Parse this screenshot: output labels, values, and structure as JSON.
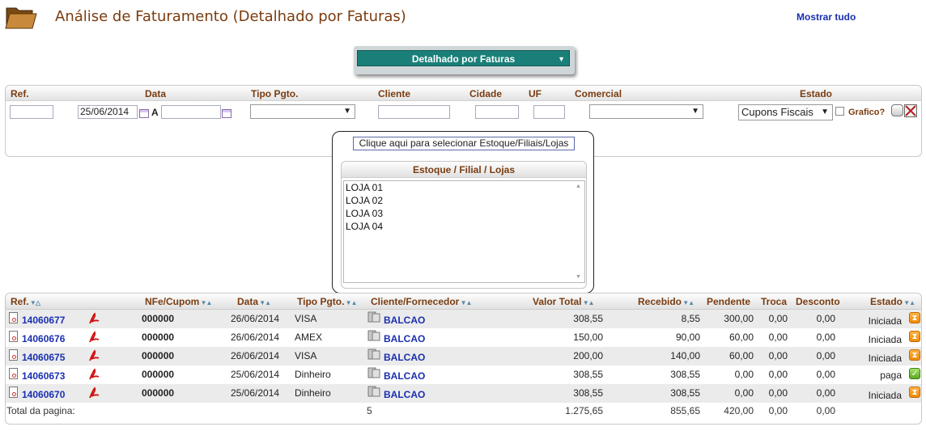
{
  "header": {
    "title": "Análise de Faturamento (Detalhado por Faturas)",
    "show_all": "Mostrar tudo",
    "view_selected": "Detalhado por Faturas"
  },
  "filters": {
    "labels": {
      "ref": "Ref.",
      "data": "Data",
      "tipo_pgto": "Tipo Pgto.",
      "cliente": "Cliente",
      "cidade": "Cidade",
      "uf": "UF",
      "comercial": "Comercial",
      "estado": "Estado"
    },
    "ref_value": "",
    "date_from": "25/06/2014",
    "date_sep": "A",
    "date_to": "",
    "tipo_pgto_value": "",
    "cliente_value": "",
    "cidade_value": "",
    "uf_value": "",
    "comercial_value": "",
    "estado_value": "Cupons Fiscais",
    "grafico_label": "Grafico?"
  },
  "stores": {
    "button_label": "Clique aqui para selecionar Estoque/Filiais/Lojas",
    "heading": "Estoque / Filial / Lojas",
    "items": [
      "LOJA 01",
      "LOJA 02",
      "LOJA 03",
      "LOJA 04"
    ]
  },
  "table": {
    "columns": {
      "ref": "Ref.",
      "nfe": "NFe/Cupom",
      "data": "Data",
      "tipo": "Tipo Pgto.",
      "cliente": "Cliente/Fornecedor",
      "valor": "Valor Total",
      "recebido": "Recebido",
      "pendente": "Pendente",
      "troca": "Troca",
      "desconto": "Desconto",
      "estado": "Estado"
    },
    "rows": [
      {
        "ref": "14060677",
        "nfe": "000000",
        "data": "26/06/2014",
        "tipo": "VISA",
        "cliente": "BALCAO",
        "valor": "308,55",
        "recebido": "8,55",
        "pendente": "300,00",
        "troca": "0,00",
        "desconto": "0,00",
        "estado": "Iniciada",
        "status_color": "#f08a00"
      },
      {
        "ref": "14060676",
        "nfe": "000000",
        "data": "26/06/2014",
        "tipo": "AMEX",
        "cliente": "BALCAO",
        "valor": "150,00",
        "recebido": "90,00",
        "pendente": "60,00",
        "troca": "0,00",
        "desconto": "0,00",
        "estado": "Iniciada",
        "status_color": "#f08a00"
      },
      {
        "ref": "14060675",
        "nfe": "000000",
        "data": "26/06/2014",
        "tipo": "VISA",
        "cliente": "BALCAO",
        "valor": "200,00",
        "recebido": "140,00",
        "pendente": "60,00",
        "troca": "0,00",
        "desconto": "0,00",
        "estado": "Iniciada",
        "status_color": "#f08a00"
      },
      {
        "ref": "14060673",
        "nfe": "000000",
        "data": "25/06/2014",
        "tipo": "Dinheiro",
        "cliente": "BALCAO",
        "valor": "308,55",
        "recebido": "308,55",
        "pendente": "0,00",
        "troca": "0,00",
        "desconto": "0,00",
        "estado": "paga",
        "status_color": "#5aaa20"
      },
      {
        "ref": "14060670",
        "nfe": "000000",
        "data": "25/06/2014",
        "tipo": "Dinheiro",
        "cliente": "BALCAO",
        "valor": "308,55",
        "recebido": "308,55",
        "pendente": "0,00",
        "troca": "0,00",
        "desconto": "0,00",
        "estado": "Iniciada",
        "status_color": "#f08a00"
      }
    ],
    "totals": {
      "label": "Total da pagina:",
      "count": "5",
      "valor": "1.275,65",
      "recebido": "855,65",
      "pendente": "420,00",
      "troca": "0,00",
      "desconto": "0,00"
    }
  }
}
